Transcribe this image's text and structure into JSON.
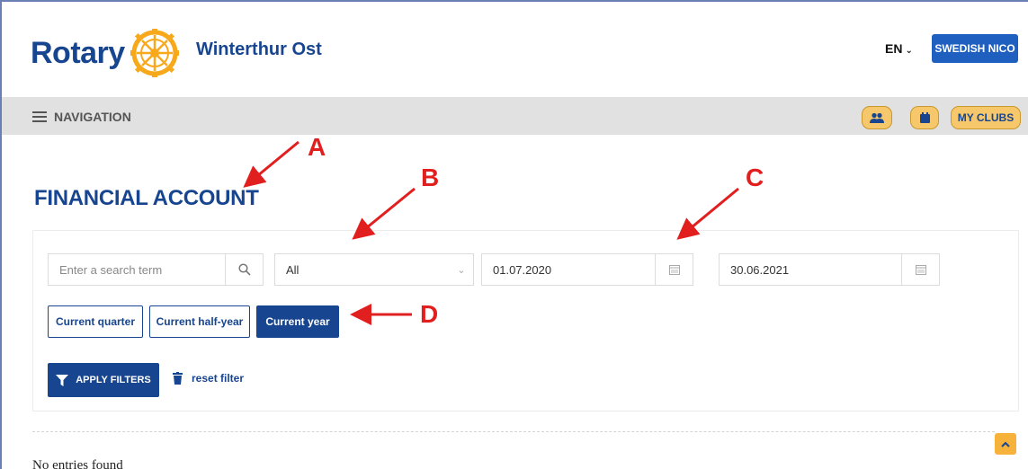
{
  "header": {
    "brand": "Rotary",
    "club_name": "Winterthur Ost",
    "language": "EN",
    "user_button": "SWEDISH NICO"
  },
  "nav": {
    "label": "NAVIGATION",
    "my_clubs": "MY CLUBS"
  },
  "page": {
    "title": "FINANCIAL ACCOUNT"
  },
  "filters": {
    "search_placeholder": "Enter a search term",
    "category_value": "All",
    "date_from": "01.07.2020",
    "date_to": "30.06.2021",
    "period_buttons": {
      "quarter": "Current quarter",
      "half_year": "Current half-year",
      "year": "Current year"
    },
    "apply_label": "APPLY FILTERS",
    "reset_label": "reset filter"
  },
  "results": {
    "empty_message": "No entries found"
  },
  "annotations": {
    "a": "A",
    "b": "B",
    "c": "C",
    "d": "D"
  },
  "colors": {
    "brand_blue": "#17458f",
    "gold": "#f7c86b",
    "annotation_red": "#e21f1f"
  }
}
